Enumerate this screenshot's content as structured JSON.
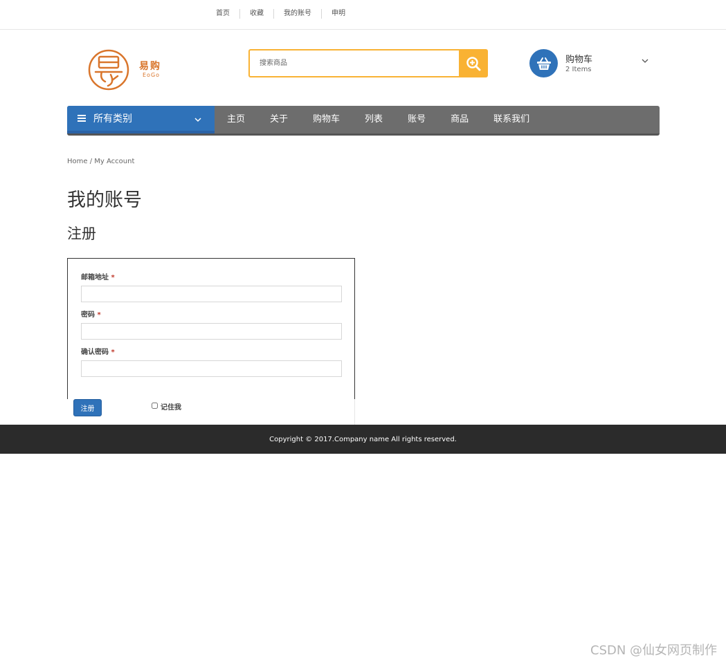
{
  "topbar": {
    "links": [
      "首页",
      "收藏",
      "我的账号",
      "申明"
    ]
  },
  "logo": {
    "cn": "易购",
    "en": "EoGo"
  },
  "search": {
    "placeholder": "搜索商品",
    "icon": "search-icon"
  },
  "cart": {
    "title": "购物车",
    "count": "2 Items",
    "icon": "basket-icon"
  },
  "nav": {
    "category_label": "所有类别",
    "items": [
      "主页",
      "关于",
      "购物车",
      "列表",
      "账号",
      "商品",
      "联系我们"
    ]
  },
  "breadcrumb": "Home / My Account",
  "page_title": "我的账号",
  "section_title": "注册",
  "form": {
    "email_label": "邮箱地址",
    "password_label": "密码",
    "confirm_label": "确认密码",
    "required_mark": "*",
    "submit_label": "注册",
    "remember_label": "记住我"
  },
  "footer": {
    "copyright": "Copyright © 2017.Company name All rights reserved."
  },
  "watermark": "CSDN @仙女网页制作",
  "colors": {
    "accent": "#f9b233",
    "primary": "#2f72b9",
    "nav_bg": "#6d6d6d",
    "footer_bg": "#2b2b2b",
    "logo": "#d9752b"
  }
}
